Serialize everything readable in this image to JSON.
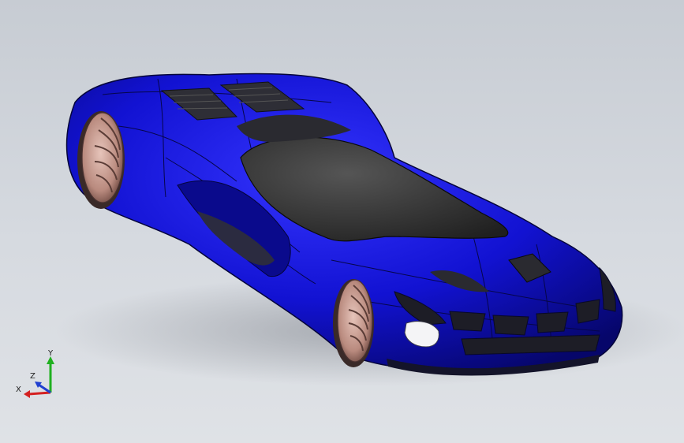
{
  "viewport": {
    "background_top": "#c7ccd3",
    "background_bottom": "#dfe2e6"
  },
  "model": {
    "body_color": "#1212d2",
    "body_dark": "#0a0a8c",
    "glass_color": "#3a3a3a",
    "wheel_color": "#c49a8f",
    "headlight_color": "#f4f4f6"
  },
  "triad": {
    "x_label": "X",
    "y_label": "Y",
    "z_label": "Z",
    "x_color": "#d42020",
    "y_color": "#20b020",
    "z_color": "#2040d0"
  }
}
